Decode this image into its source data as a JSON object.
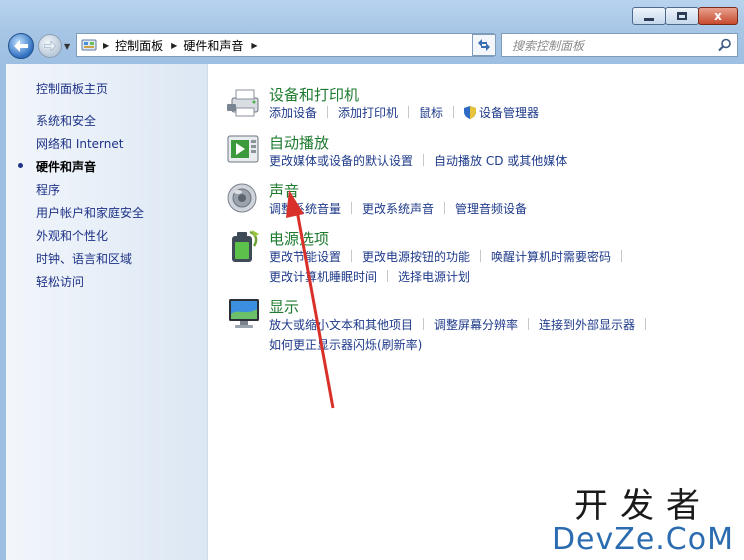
{
  "window": {
    "caption_buttons": [
      "minimize-icon",
      "maximize-icon",
      "close-icon"
    ],
    "close_label": "x"
  },
  "navigation": {
    "breadcrumb": [
      "控制面板",
      "硬件和声音"
    ],
    "search_placeholder": "搜索控制面板"
  },
  "sidebar": {
    "items": [
      {
        "label": "控制面板主页",
        "current": false
      },
      {
        "label": "系统和安全",
        "current": false
      },
      {
        "label": "网络和 Internet",
        "current": false
      },
      {
        "label": "硬件和声音",
        "current": true
      },
      {
        "label": "程序",
        "current": false
      },
      {
        "label": "用户帐户和家庭安全",
        "current": false
      },
      {
        "label": "外观和个性化",
        "current": false
      },
      {
        "label": "时钟、语言和区域",
        "current": false
      },
      {
        "label": "轻松访问",
        "current": false
      }
    ]
  },
  "categories": [
    {
      "title": "设备和打印机",
      "icon": "printer-icon",
      "links": [
        [
          "添加设备",
          "添加打印机",
          "鼠标",
          "设备管理器"
        ]
      ]
    },
    {
      "title": "自动播放",
      "icon": "autoplay-icon",
      "links": [
        [
          "更改媒体或设备的默认设置",
          "自动播放 CD 或其他媒体"
        ]
      ]
    },
    {
      "title": "声音",
      "icon": "speaker-icon",
      "links": [
        [
          "调整系统音量",
          "更改系统声音",
          "管理音频设备"
        ]
      ]
    },
    {
      "title": "电源选项",
      "icon": "battery-icon",
      "links": [
        [
          "更改节能设置",
          "更改电源按钮的功能",
          "唤醒计算机时需要密码"
        ],
        [
          "更改计算机睡眠时间",
          "选择电源计划"
        ]
      ]
    },
    {
      "title": "显示",
      "icon": "monitor-icon",
      "links": [
        [
          "放大或缩小文本和其他项目",
          "调整屏幕分辨率",
          "连接到外部显示器"
        ],
        [
          "如何更正显示器闪烁(刷新率)"
        ]
      ]
    }
  ],
  "watermark": {
    "line1": "开发者",
    "line2": "DevZe.CoM"
  },
  "colors": {
    "link": "#1e3a8a",
    "title_green": "#1e7a2f",
    "arrow": "#d9302a",
    "watermark_blue": "#2b6cb0"
  }
}
